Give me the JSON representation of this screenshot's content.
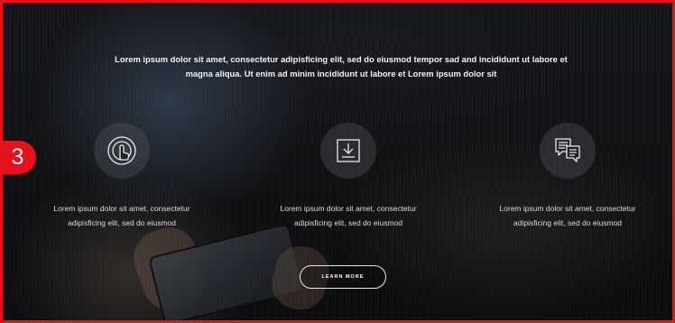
{
  "step_badge": "3",
  "intro_text": "Lorem ipsum dolor sit amet, consectetur adipisficing elit, sed do eiusmod tempor sad and incididunt ut labore et magna aliqua. Ut enim ad minim incididunt ut labore et Lorem ipsum dolor sit",
  "features": [
    {
      "icon": "touch-icon",
      "text_line1": "Lorem ipsum dolor sit amet, consectetur",
      "text_line2": "adipisficing elit, sed do eiusmod"
    },
    {
      "icon": "download-icon",
      "text_line1": "Lorem ipsum dolor sit amet, consectetur",
      "text_line2": "adipisficing elit, sed do eiusmod"
    },
    {
      "icon": "chat-icon",
      "text_line1": "Lorem ipsum dolor sit amet, consectetur",
      "text_line2": "adipisficing elit, sed do eiusmod"
    }
  ],
  "cta_label": "LEARN MORE",
  "colors": {
    "accent": "#e3121b",
    "text": "#f2f2f2"
  }
}
